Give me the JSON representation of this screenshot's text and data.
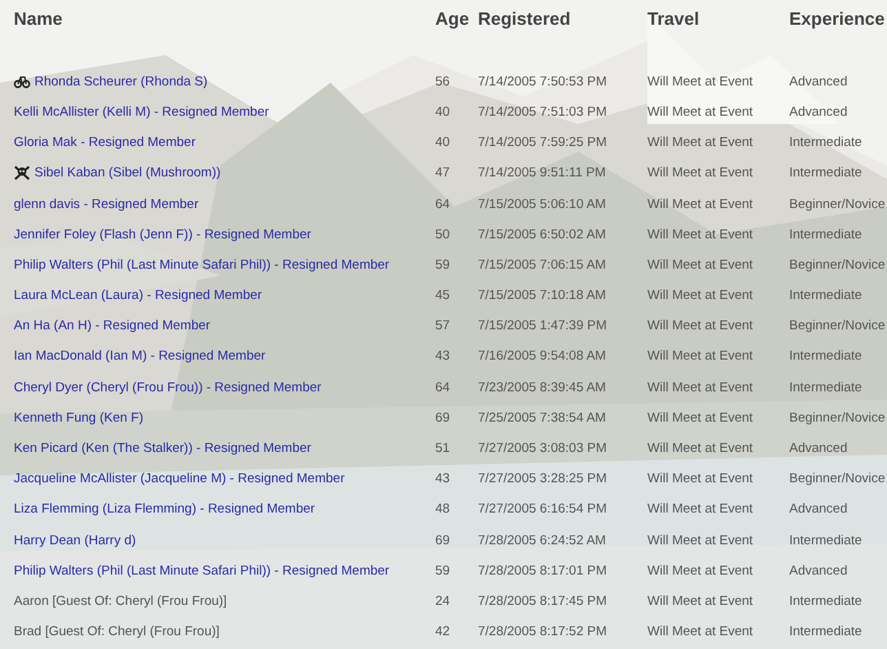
{
  "table": {
    "columns": [
      "Name",
      "Age",
      "Registered",
      "Travel",
      "Experience"
    ],
    "rows": [
      {
        "kind": "member",
        "icon": {
          "kind": "bicycle"
        },
        "name": "Rhonda Scheurer (Rhonda S)",
        "age": "56",
        "registered": "7/14/2005 7:50:53 PM",
        "travel": "Will Meet at Event",
        "experience": "Advanced"
      },
      {
        "kind": "member",
        "name": "Kelli McAllister (Kelli M) - Resigned Member",
        "age": "40",
        "registered": "7/14/2005 7:51:03 PM",
        "travel": "Will Meet at Event",
        "experience": "Advanced"
      },
      {
        "kind": "member",
        "name": "Gloria Mak - Resigned Member",
        "age": "40",
        "registered": "7/14/2005 7:59:25 PM",
        "travel": "Will Meet at Event",
        "experience": "Intermediate"
      },
      {
        "kind": "member",
        "icon": {
          "kind": "skull"
        },
        "name": "Sibel Kaban (Sibel (Mushroom))",
        "age": "47",
        "registered": "7/14/2005 9:51:11 PM",
        "travel": "Will Meet at Event",
        "experience": "Intermediate"
      },
      {
        "kind": "member",
        "name": "glenn davis - Resigned Member",
        "age": "64",
        "registered": "7/15/2005 5:06:10 AM",
        "travel": "Will Meet at Event",
        "experience": "Beginner/Novice"
      },
      {
        "kind": "member",
        "name": "Jennifer Foley (Flash (Jenn F)) - Resigned Member",
        "age": "50",
        "registered": "7/15/2005 6:50:02 AM",
        "travel": "Will Meet at Event",
        "experience": "Intermediate"
      },
      {
        "kind": "member",
        "name": "Philip Walters (Phil (Last Minute Safari Phil)) - Resigned Member",
        "age": "59",
        "registered": "7/15/2005 7:06:15 AM",
        "travel": "Will Meet at Event",
        "experience": "Beginner/Novice"
      },
      {
        "kind": "member",
        "name": "Laura McLean (Laura) - Resigned Member",
        "age": "45",
        "registered": "7/15/2005 7:10:18 AM",
        "travel": "Will Meet at Event",
        "experience": "Intermediate"
      },
      {
        "kind": "member",
        "name": "An Ha (An H) - Resigned Member",
        "age": "57",
        "registered": "7/15/2005 1:47:39 PM",
        "travel": "Will Meet at Event",
        "experience": "Beginner/Novice"
      },
      {
        "kind": "member",
        "name": "Ian MacDonald (Ian M) - Resigned Member",
        "age": "43",
        "registered": "7/16/2005 9:54:08 AM",
        "travel": "Will Meet at Event",
        "experience": "Intermediate"
      },
      {
        "kind": "member",
        "name": "Cheryl Dyer (Cheryl (Frou Frou)) - Resigned Member",
        "age": "64",
        "registered": "7/23/2005 8:39:45 AM",
        "travel": "Will Meet at Event",
        "experience": "Intermediate"
      },
      {
        "kind": "member",
        "name": "Kenneth Fung (Ken F)",
        "age": "69",
        "registered": "7/25/2005 7:38:54 AM",
        "travel": "Will Meet at Event",
        "experience": "Beginner/Novice"
      },
      {
        "kind": "member",
        "name": "Ken Picard (Ken (The Stalker)) - Resigned Member",
        "age": "51",
        "registered": "7/27/2005 3:08:03 PM",
        "travel": "Will Meet at Event",
        "experience": "Advanced"
      },
      {
        "kind": "member",
        "name": "Jacqueline McAllister (Jacqueline M) - Resigned Member",
        "age": "43",
        "registered": "7/27/2005 3:28:25 PM",
        "travel": "Will Meet at Event",
        "experience": "Beginner/Novice"
      },
      {
        "kind": "member",
        "name": "Liza Flemming (Liza Flemming) - Resigned Member",
        "age": "48",
        "registered": "7/27/2005 6:16:54 PM",
        "travel": "Will Meet at Event",
        "experience": "Advanced"
      },
      {
        "kind": "member",
        "name": "Harry Dean (Harry d)",
        "age": "69",
        "registered": "7/28/2005 6:24:52 AM",
        "travel": "Will Meet at Event",
        "experience": "Intermediate"
      },
      {
        "kind": "member",
        "name": "Philip Walters (Phil (Last Minute Safari Phil)) - Resigned Member",
        "age": "59",
        "registered": "7/28/2005 8:17:01 PM",
        "travel": "Will Meet at Event",
        "experience": "Advanced"
      },
      {
        "kind": "guest",
        "name": "Aaron [Guest Of: Cheryl (Frou Frou)]",
        "age": "24",
        "registered": "7/28/2005 8:17:45 PM",
        "travel": "Will Meet at Event",
        "experience": "Intermediate"
      },
      {
        "kind": "guest",
        "name": "Brad [Guest Of: Cheryl (Frou Frou)]",
        "age": "42",
        "registered": "7/28/2005 8:17:52 PM",
        "travel": "Will Meet at Event",
        "experience": "Intermediate"
      }
    ]
  }
}
